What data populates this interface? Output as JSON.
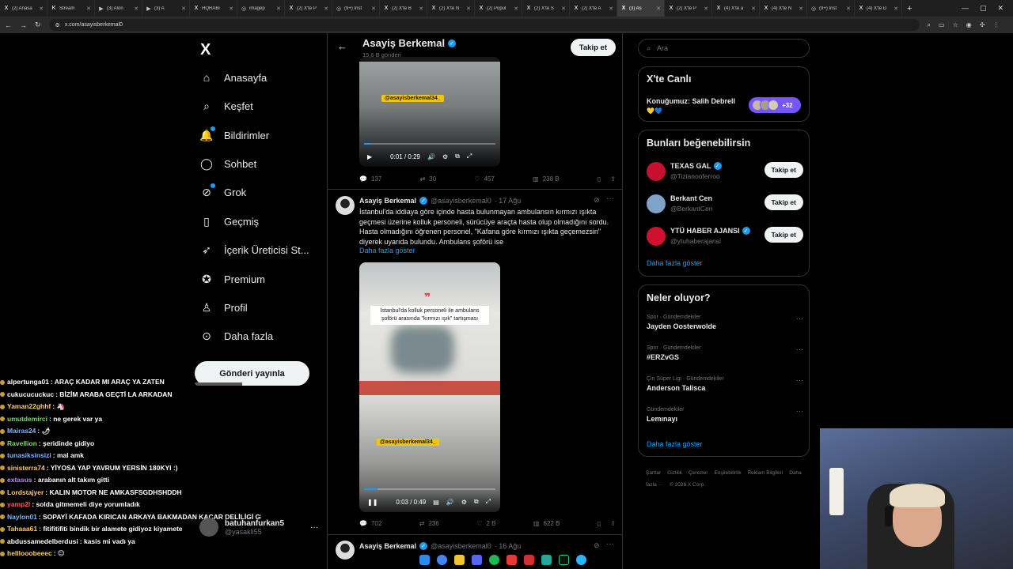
{
  "browser": {
    "tabs": [
      {
        "icon": "X",
        "label": "(2) Anasa"
      },
      {
        "icon": "K",
        "label": "Stream"
      },
      {
        "icon": "▶",
        "label": "(3) Alon"
      },
      {
        "icon": "▶",
        "label": "(3) A"
      },
      {
        "icon": "X",
        "label": "HQRABi"
      },
      {
        "icon": "◎",
        "label": "imagep"
      },
      {
        "icon": "X",
        "label": "(2) X'te P"
      },
      {
        "icon": "◎",
        "label": "(9+) Inst"
      },
      {
        "icon": "X",
        "label": "(2) X'te B"
      },
      {
        "icon": "X",
        "label": "(2) X'te N"
      },
      {
        "icon": "X",
        "label": "(2) Popul"
      },
      {
        "icon": "X",
        "label": "(2) X'te S"
      },
      {
        "icon": "X",
        "label": "(2) X'te A"
      },
      {
        "icon": "X",
        "label": "(3) As"
      },
      {
        "icon": "X",
        "label": "(2) X'te P"
      },
      {
        "icon": "X",
        "label": "(4) X'te a"
      },
      {
        "icon": "X",
        "label": "(4) X'te N"
      },
      {
        "icon": "◎",
        "label": "(9+) Inst"
      },
      {
        "icon": "X",
        "label": "(4) X'te D"
      }
    ],
    "url": "x.com/asayisberkemal0"
  },
  "nav": {
    "logo": "X",
    "items": [
      {
        "label": "Anasayfa",
        "icon": "home-icon",
        "glyph": "⌂"
      },
      {
        "label": "Keşfet",
        "icon": "search-icon",
        "glyph": "⌕"
      },
      {
        "label": "Bildirimler",
        "icon": "bell-icon",
        "glyph": "🔔"
      },
      {
        "label": "Sohbet",
        "icon": "chat-icon",
        "glyph": "◯"
      },
      {
        "label": "Grok",
        "icon": "grok-icon",
        "glyph": "⊘"
      },
      {
        "label": "Geçmiş",
        "icon": "bookmark-icon",
        "glyph": "▯"
      },
      {
        "label": "İçerik Üreticisi St...",
        "icon": "rocket-icon",
        "glyph": "➶"
      },
      {
        "label": "Premium",
        "icon": "premium-icon",
        "glyph": "✪"
      },
      {
        "label": "Profil",
        "icon": "person-icon",
        "glyph": "♙"
      },
      {
        "label": "Daha fazla",
        "icon": "more-circle-icon",
        "glyph": "⊙"
      }
    ],
    "post_label": "Gönderi yayınla"
  },
  "account": {
    "name": "batuhanfurkan5",
    "handle": "@yasakli55"
  },
  "chat": [
    {
      "user": "alpertunga01",
      "color": "#ffffff",
      "msg": "ARAÇ KADAR MI ARAÇ YA ZATEN"
    },
    {
      "user": "cukucucuckuc",
      "color": "#ffffff",
      "msg": "BİZİM ARABA GEÇTİ LA ARKADAN"
    },
    {
      "user": "Yaman22ghhf",
      "color": "#ffcc66",
      "msg": "🦄"
    },
    {
      "user": "umutdemirci",
      "color": "#7dd96a",
      "msg": "ne gerek var ya"
    },
    {
      "user": "Mairas24",
      "color": "#7ab8ff",
      "msg": "🌶"
    },
    {
      "user": "Ravellion",
      "color": "#7dd96a",
      "msg": "şeridinde gidiyo"
    },
    {
      "user": "tunasiksinsizi",
      "color": "#7ab8ff",
      "msg": "mal amk"
    },
    {
      "user": "sinisterra74",
      "color": "#ffcc66",
      "msg": "YİYOSA YAP YAVRUM YERSİN 180KYI :)"
    },
    {
      "user": "extasus",
      "color": "#b48cff",
      "msg": "arabanın alt takım gitti"
    },
    {
      "user": "Lordstajyer",
      "color": "#ffcc66",
      "msg": "KALIN MOTOR NE AMKASFSGDHSHDDH"
    },
    {
      "user": "yamp2l",
      "color": "#ff5c5c",
      "msg": "solda gitmemeli diye yorumladık"
    },
    {
      "user": "Naylon01",
      "color": "#7ab8ff",
      "msg": "SOPAYİ KAFADA KIRICAN ARKAYA BAKMADAN KACAR DELİLİGİ GİDER"
    },
    {
      "user": "Tahaaa61",
      "color": "#ffcc66",
      "msg": "fitifitifiti bindik bir alamete gidiyoz kiyamete"
    },
    {
      "user": "abdussamedelberdusi",
      "color": "#ffffff",
      "msg": "kasis mi vadı ya"
    },
    {
      "user": "helllooobeeec",
      "color": "#ffcc66",
      "msg": "😊"
    }
  ],
  "profile": {
    "name": "Asayiş Berkemal",
    "post_count": "15,6 B gönderi",
    "follow_label": "Takip et"
  },
  "tweet1": {
    "watermark": "@asayisberkemal34_",
    "time": "0:01 / 0:29",
    "progress": 0.05,
    "replies": "137",
    "reposts": "30",
    "likes": "457",
    "views": "238 B"
  },
  "tweet2": {
    "name": "Asayiş Berkemal",
    "handle": "@asayisberkemal0",
    "date": "· 17 Ağu",
    "text": "İstanbul'da iddiaya göre içinde hasta bulunmayan ambulansın kırmızı ışıkta geçmesi üzerine kolluk personeli, sürücüye araçta hasta olup olmadığını sordu. Hasta olmadığını öğrenen personel, \"Kafana göre kırmızı ışıkta geçemezsin\" diyerek uyarıda bulundu. Ambulans şoförü ise",
    "show_more": "Daha fazla göster",
    "caption": "İstanbul'da kolluk personeli ile ambulans şoförü arasında \"kırmızı ışık\" tartışması",
    "watermark": "@asayisberkemal34_",
    "time": "0:03 / 0:49",
    "progress": 0.1,
    "replies": "702",
    "reposts": "236",
    "likes": "2 B",
    "views": "622 B"
  },
  "tweet3": {
    "name": "Asayiş Berkemal",
    "handle": "@asayisberkemal0",
    "date": "· 16 Ağu"
  },
  "right": {
    "search_placeholder": "Ara",
    "live_title": "X'te Canlı",
    "live_topic": "Konuğumuz: Salih Debrell",
    "live_hearts": "💛💙",
    "live_count": "+32",
    "suggest_title": "Bunları beğenebilirsin",
    "suggestions": [
      {
        "name": "TEXAS GAL",
        "verified": true,
        "handle": "@Tizianooferroo",
        "button": "Takip et",
        "color": "#c8102e"
      },
      {
        "name": "Berkant Cen",
        "verified": false,
        "handle": "@BerkantCen",
        "button": "Takip et",
        "color": "#7fa3c8"
      },
      {
        "name": "YTÜ HABER AJANSI",
        "verified": true,
        "handle": "@ytuhaberajansi",
        "button": "Takip et",
        "color": "#d0102e"
      }
    ],
    "suggest_more": "Daha fazla göster",
    "trends_title": "Neler oluyor?",
    "trends": [
      {
        "category": "Spor · Gündemdekiler",
        "title": "Jayden Oosterwolde"
      },
      {
        "category": "Spor · Gündemdekiler",
        "title": "#ERZvGS"
      },
      {
        "category": "Çin Süper Ligi · Gündemdekiler",
        "title": "Anderson Talisca"
      },
      {
        "category": "Gündemdekiler",
        "title": "Lemınayı"
      }
    ],
    "trends_more": "Daha fazla göster",
    "footer": [
      "Şartlar",
      "Gizlilik",
      "Çerezler",
      "Erişilebilirlik",
      "Reklam Bilgileri",
      "Daha fazla ···",
      "© 2026 X Corp."
    ]
  },
  "colors": {
    "accent": "#1d9bf0",
    "bg": "#000000",
    "border": "#2f3336",
    "muted": "#71767b"
  }
}
